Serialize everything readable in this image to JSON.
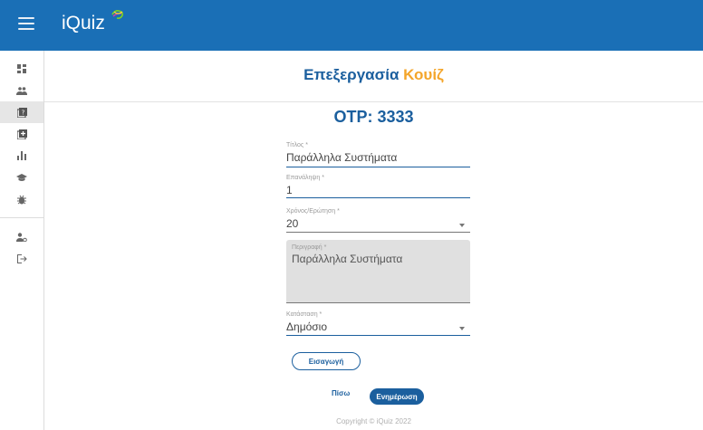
{
  "app": {
    "name": "iQuiz",
    "brand_color": "#1a6fb6",
    "accent_color": "#f4a52a"
  },
  "header": {
    "menu_icon": "hamburger-icon",
    "logo": "iQuiz"
  },
  "sidebar": {
    "items": [
      {
        "icon": "dashboard-icon"
      },
      {
        "icon": "people-icon"
      },
      {
        "icon": "quiz-icon",
        "active": true
      },
      {
        "icon": "add-box-icon"
      },
      {
        "icon": "bar-chart-icon"
      },
      {
        "icon": "school-icon"
      },
      {
        "icon": "bug-icon"
      },
      {
        "icon": "manage-accounts-icon"
      },
      {
        "icon": "logout-icon"
      }
    ]
  },
  "page": {
    "title_main": "Επεξεργασία",
    "title_accent": "Κουίζ",
    "otp": "OTP: 3333"
  },
  "form": {
    "title": {
      "label": "Τίτλος *",
      "value": "Παράλληλα Συστήματα"
    },
    "repeat": {
      "label": "Επανάληψη *",
      "value": "1"
    },
    "time_per_question": {
      "label": "Χρόνος/Ερώτηση *",
      "value": "20"
    },
    "description": {
      "label": "Περιγραφή *",
      "value": "Παράλληλα Συστήματα"
    },
    "status": {
      "label": "Κατάσταση *",
      "value": "Δημόσιο"
    }
  },
  "buttons": {
    "insert": "Εισαγωγή",
    "back": "Πίσω",
    "update": "Ενημέρωση"
  },
  "footer": {
    "copyright": "Copyright © iQuiz 2022"
  }
}
